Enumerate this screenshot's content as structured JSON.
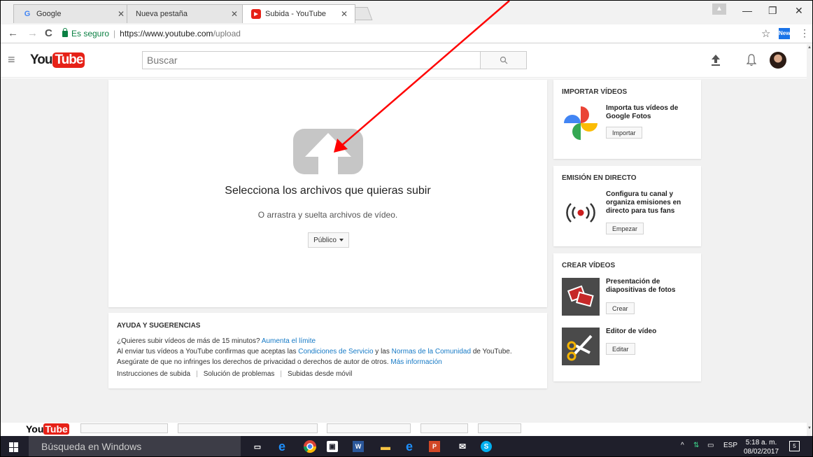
{
  "browser": {
    "tabs": [
      {
        "label": "Google",
        "icon": "G"
      },
      {
        "label": "Nueva pestaña",
        "icon": ""
      },
      {
        "label": "Subida - YouTube",
        "icon": "▶"
      }
    ],
    "secure_label": "Es seguro",
    "url_base": "https://www.youtube.com",
    "url_path": "/upload",
    "extension_label": "New"
  },
  "youtube": {
    "logo_you": "You",
    "logo_tube": "Tube",
    "search_placeholder": "Buscar",
    "upload": {
      "title": "Selecciona los archivos que quieras subir",
      "subtitle": "O arrastra y suelta archivos de vídeo.",
      "privacy": "Público"
    },
    "help": {
      "title": "AYUDA Y SUGERENCIAS",
      "line1_text": "¿Quieres subir vídeos de más de 15 minutos?",
      "line1_link": "Aumenta el límite",
      "line2_pre": "Al enviar tus vídeos a YouTube confirmas que aceptas las",
      "line2_link1": "Condiciones de Servicio",
      "line2_mid": "y las",
      "line2_link2": "Normas de la Comunidad",
      "line2_post": "de YouTube.",
      "line3_text": "Asegúrate de que no infringes los derechos de privacidad o derechos de autor de otros.",
      "line3_link": "Más información",
      "links": [
        "Instrucciones de subida",
        "Solución de problemas",
        "Subidas desde móvil"
      ]
    },
    "import": {
      "title": "IMPORTAR VÍDEOS",
      "desc": "Importa tus vídeos de Google Fotos",
      "button": "Importar"
    },
    "live": {
      "title": "EMISIÓN EN DIRECTO",
      "desc": "Configura tu canal y organiza emisiones en directo para tus fans",
      "button": "Empezar"
    },
    "create": {
      "title": "CREAR VÍDEOS",
      "slideshow_desc": "Presentación de diapositivas de fotos",
      "slideshow_button": "Crear",
      "editor_desc": "Editor de vídeo",
      "editor_button": "Editar"
    }
  },
  "taskbar": {
    "search_placeholder": "Búsqueda en Windows",
    "language": "ESP",
    "time": "5:18 a. m.",
    "date": "08/02/2017",
    "notifications": "5"
  },
  "colors": {
    "youtube_red": "#e62117",
    "link_blue": "#167ac6",
    "annotation_arrow": "#ff0000"
  }
}
